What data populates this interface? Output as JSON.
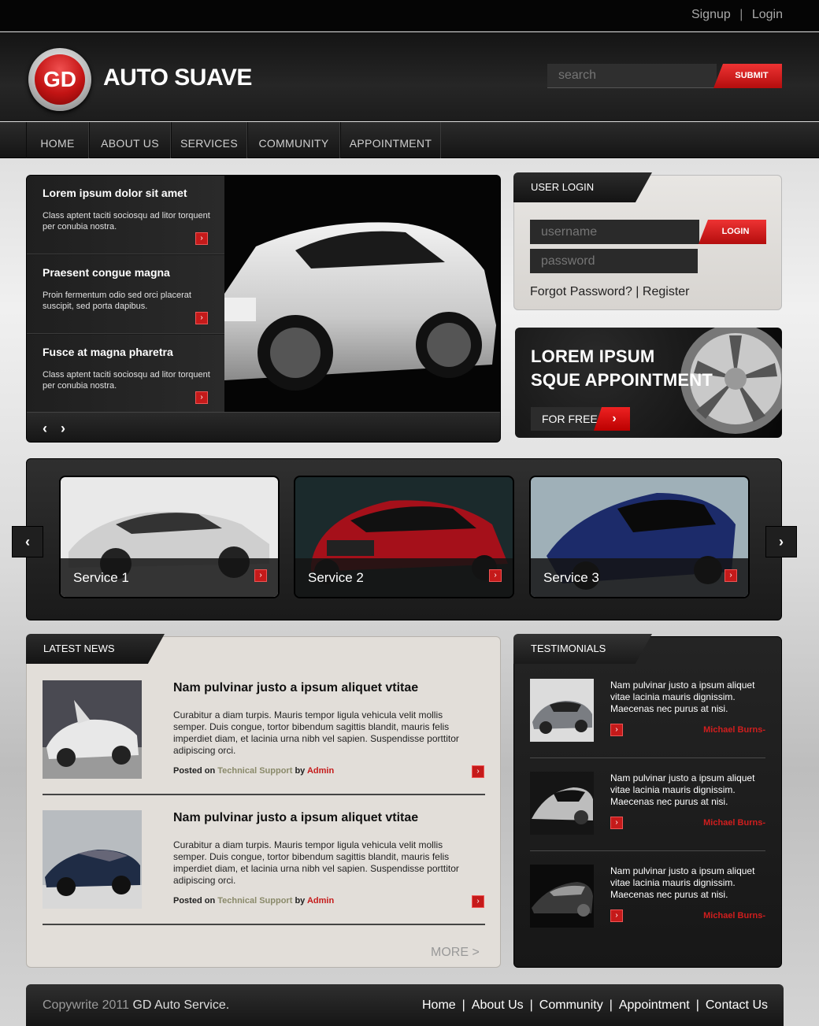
{
  "top_links": {
    "signup": "Signup",
    "sep": "|",
    "login": "Login"
  },
  "header": {
    "logo_badge": "GD",
    "brand": "AUTO SUAVE",
    "search_placeholder": "search",
    "submit": "SUBMIT"
  },
  "nav": [
    {
      "label": "HOME"
    },
    {
      "label": "ABOUT US"
    },
    {
      "label": "SERVICES"
    },
    {
      "label": "COMMUNITY"
    },
    {
      "label": "APPOINTMENT"
    }
  ],
  "slider": {
    "items": [
      {
        "title": "Lorem ipsum dolor sit amet",
        "text": "Class aptent taciti sociosqu ad litor torquent per conubia nostra."
      },
      {
        "title": "Praesent congue magna",
        "text": "Proin fermentum odio sed orci placerat suscipit, sed porta dapibus."
      },
      {
        "title": "Fusce at magna pharetra",
        "text": "Class aptent taciti sociosqu ad litor torquent per conubia nostra."
      }
    ],
    "controls": "‹ ›"
  },
  "user_login": {
    "heading": "USER LOGIN",
    "username_placeholder": "username",
    "password_placeholder": "password",
    "button": "LOGIN",
    "forgot": "Forgot Password?",
    "sep": "|",
    "register": "Register"
  },
  "appointment": {
    "line1": "LOREM IPSUM",
    "line2": "SQUE APPOINTMENT",
    "button": "FOR FREE"
  },
  "services": [
    {
      "label": "Service 1"
    },
    {
      "label": "Service 2"
    },
    {
      "label": "Service 3"
    }
  ],
  "news": {
    "heading": "LATEST NEWS",
    "items": [
      {
        "title": "Nam pulvinar justo a ipsum aliquet vtitae",
        "text": "Curabitur a diam turpis. Mauris tempor ligula vehicula velit mollis semper. Duis congue, tortor bibendum sagittis blandit, mauris felis imperdiet diam, et lacinia urna nibh vel sapien. Suspendisse porttitor adipiscing orci.",
        "posted_on": "Posted on",
        "category": "Technical Support",
        "by": "by",
        "author": "Admin"
      },
      {
        "title": "Nam pulvinar justo a ipsum aliquet vtitae",
        "text": "Curabitur a diam turpis. Mauris tempor ligula vehicula velit mollis semper. Duis congue, tortor bibendum sagittis blandit, mauris felis imperdiet diam, et lacinia urna nibh vel sapien. Suspendisse porttitor adipiscing orci.",
        "posted_on": "Posted on",
        "category": "Technical Support",
        "by": "by",
        "author": "Admin"
      }
    ],
    "more": "MORE  >"
  },
  "testimonials": {
    "heading": "TESTIMONIALS",
    "items": [
      {
        "text": "Nam pulvinar justo a ipsum aliquet vitae lacinia mauris dignissim. Maecenas nec purus at nisi.",
        "author": "Michael Burns-"
      },
      {
        "text": "Nam pulvinar justo a ipsum aliquet vitae lacinia mauris dignissim. Maecenas nec purus at nisi.",
        "author": "Michael Burns-"
      },
      {
        "text": "Nam pulvinar justo a ipsum aliquet vitae lacinia mauris dignissim. Maecenas nec purus at nisi.",
        "author": "Michael Burns-"
      }
    ]
  },
  "footer": {
    "copy_prefix": "Copywrite 2011",
    "copy_brand": "GD Auto Service.",
    "links": [
      "Home",
      "About Us",
      "Community",
      "Appointment",
      "Contact Us"
    ]
  },
  "colors": {
    "accent": "#c51a1a",
    "dark": "#1a1a1a",
    "panel_light": "#e2ded9"
  }
}
